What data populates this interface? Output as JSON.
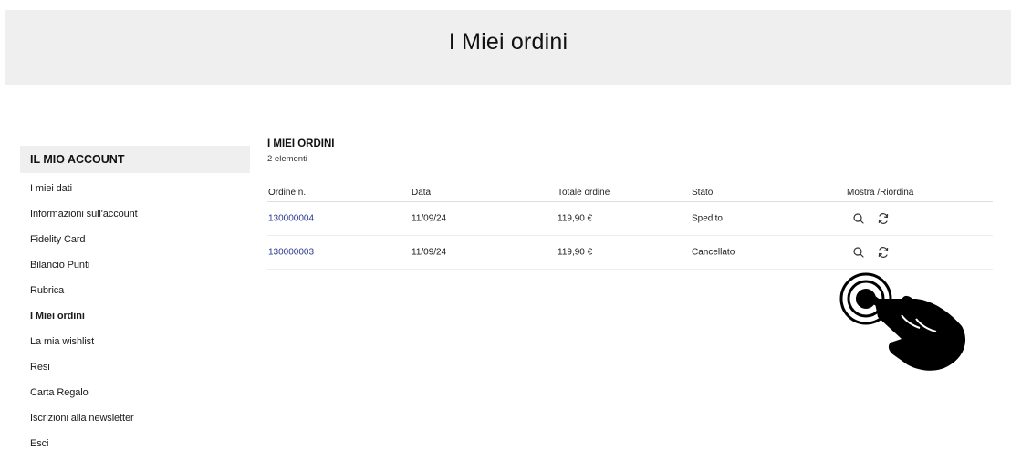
{
  "header": {
    "title": "I Miei ordini"
  },
  "sidebar": {
    "title": "IL MIO ACCOUNT",
    "items": [
      {
        "label": "I miei dati"
      },
      {
        "label": "Informazioni sull'account"
      },
      {
        "label": "Fidelity Card"
      },
      {
        "label": "Bilancio Punti"
      },
      {
        "label": "Rubrica"
      },
      {
        "label": "I Miei ordini",
        "active": true
      },
      {
        "label": "La mia wishlist"
      },
      {
        "label": "Resi"
      },
      {
        "label": "Carta Regalo"
      },
      {
        "label": "Iscrizioni alla newsletter"
      },
      {
        "label": "Esci"
      }
    ]
  },
  "orders": {
    "title": "I MIEI ORDINI",
    "count": "2 elementi",
    "columns": {
      "order": "Ordine n.",
      "date": "Data",
      "total": "Totale ordine",
      "status": "Stato",
      "actions": "Mostra /Riordina"
    },
    "rows": [
      {
        "order": "130000004",
        "date": "11/09/24",
        "total": "119,90 €",
        "status": "Spedito"
      },
      {
        "order": "130000003",
        "date": "11/09/24",
        "total": "119,90 €",
        "status": "Cancellato"
      }
    ]
  },
  "icons": {
    "view": "search-icon",
    "reorder": "refresh-icon",
    "cursor": "hand-pointer-icon"
  },
  "colors": {
    "header_bg": "#efefef",
    "link": "#2b3990",
    "text": "#1a1a1a"
  }
}
